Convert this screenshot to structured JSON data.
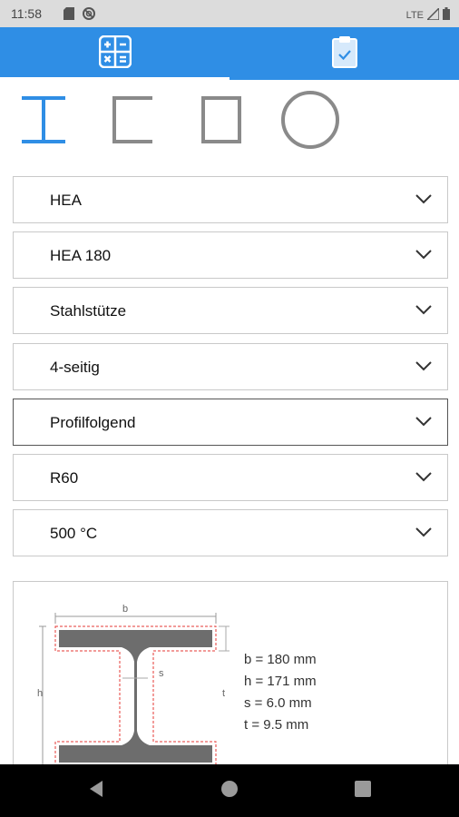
{
  "status_bar": {
    "time": "11:58",
    "left_icons": [
      "sd-card-icon",
      "do-not-disturb-icon"
    ],
    "network": "LTE",
    "right_icons": [
      "signal-icon",
      "battery-icon"
    ]
  },
  "tabs": [
    {
      "name": "calculator",
      "icon": "calculator-icon",
      "active": true
    },
    {
      "name": "report",
      "icon": "clipboard-check-icon",
      "active": false
    }
  ],
  "shapes": [
    {
      "name": "i-beam",
      "icon": "i-beam-icon",
      "selected": true
    },
    {
      "name": "u-channel",
      "icon": "u-channel-icon",
      "selected": false
    },
    {
      "name": "square-tube",
      "icon": "square-tube-icon",
      "selected": false
    },
    {
      "name": "round-tube",
      "icon": "round-tube-icon",
      "selected": false
    }
  ],
  "dropdowns": [
    {
      "value": "HEA"
    },
    {
      "value": "HEA 180"
    },
    {
      "value": "Stahlstütze"
    },
    {
      "value": "4-seitig"
    },
    {
      "value": "Profilfolgend"
    },
    {
      "value": "R60"
    },
    {
      "value": "500 °C"
    }
  ],
  "profile_diagram": {
    "labels": {
      "b": "b",
      "h": "h",
      "s": "s",
      "t": "t"
    },
    "dimensions": [
      "b = 180 mm",
      "h = 171 mm",
      "s = 6.0 mm",
      "t = 9.5 mm"
    ]
  },
  "colors": {
    "accent": "#2f8ee5",
    "shape_selected": "#2f8ee5",
    "shape_unselected": "#8a8a8a",
    "beam_fill": "#6d6d6d",
    "fire_outline": "#e53935"
  }
}
